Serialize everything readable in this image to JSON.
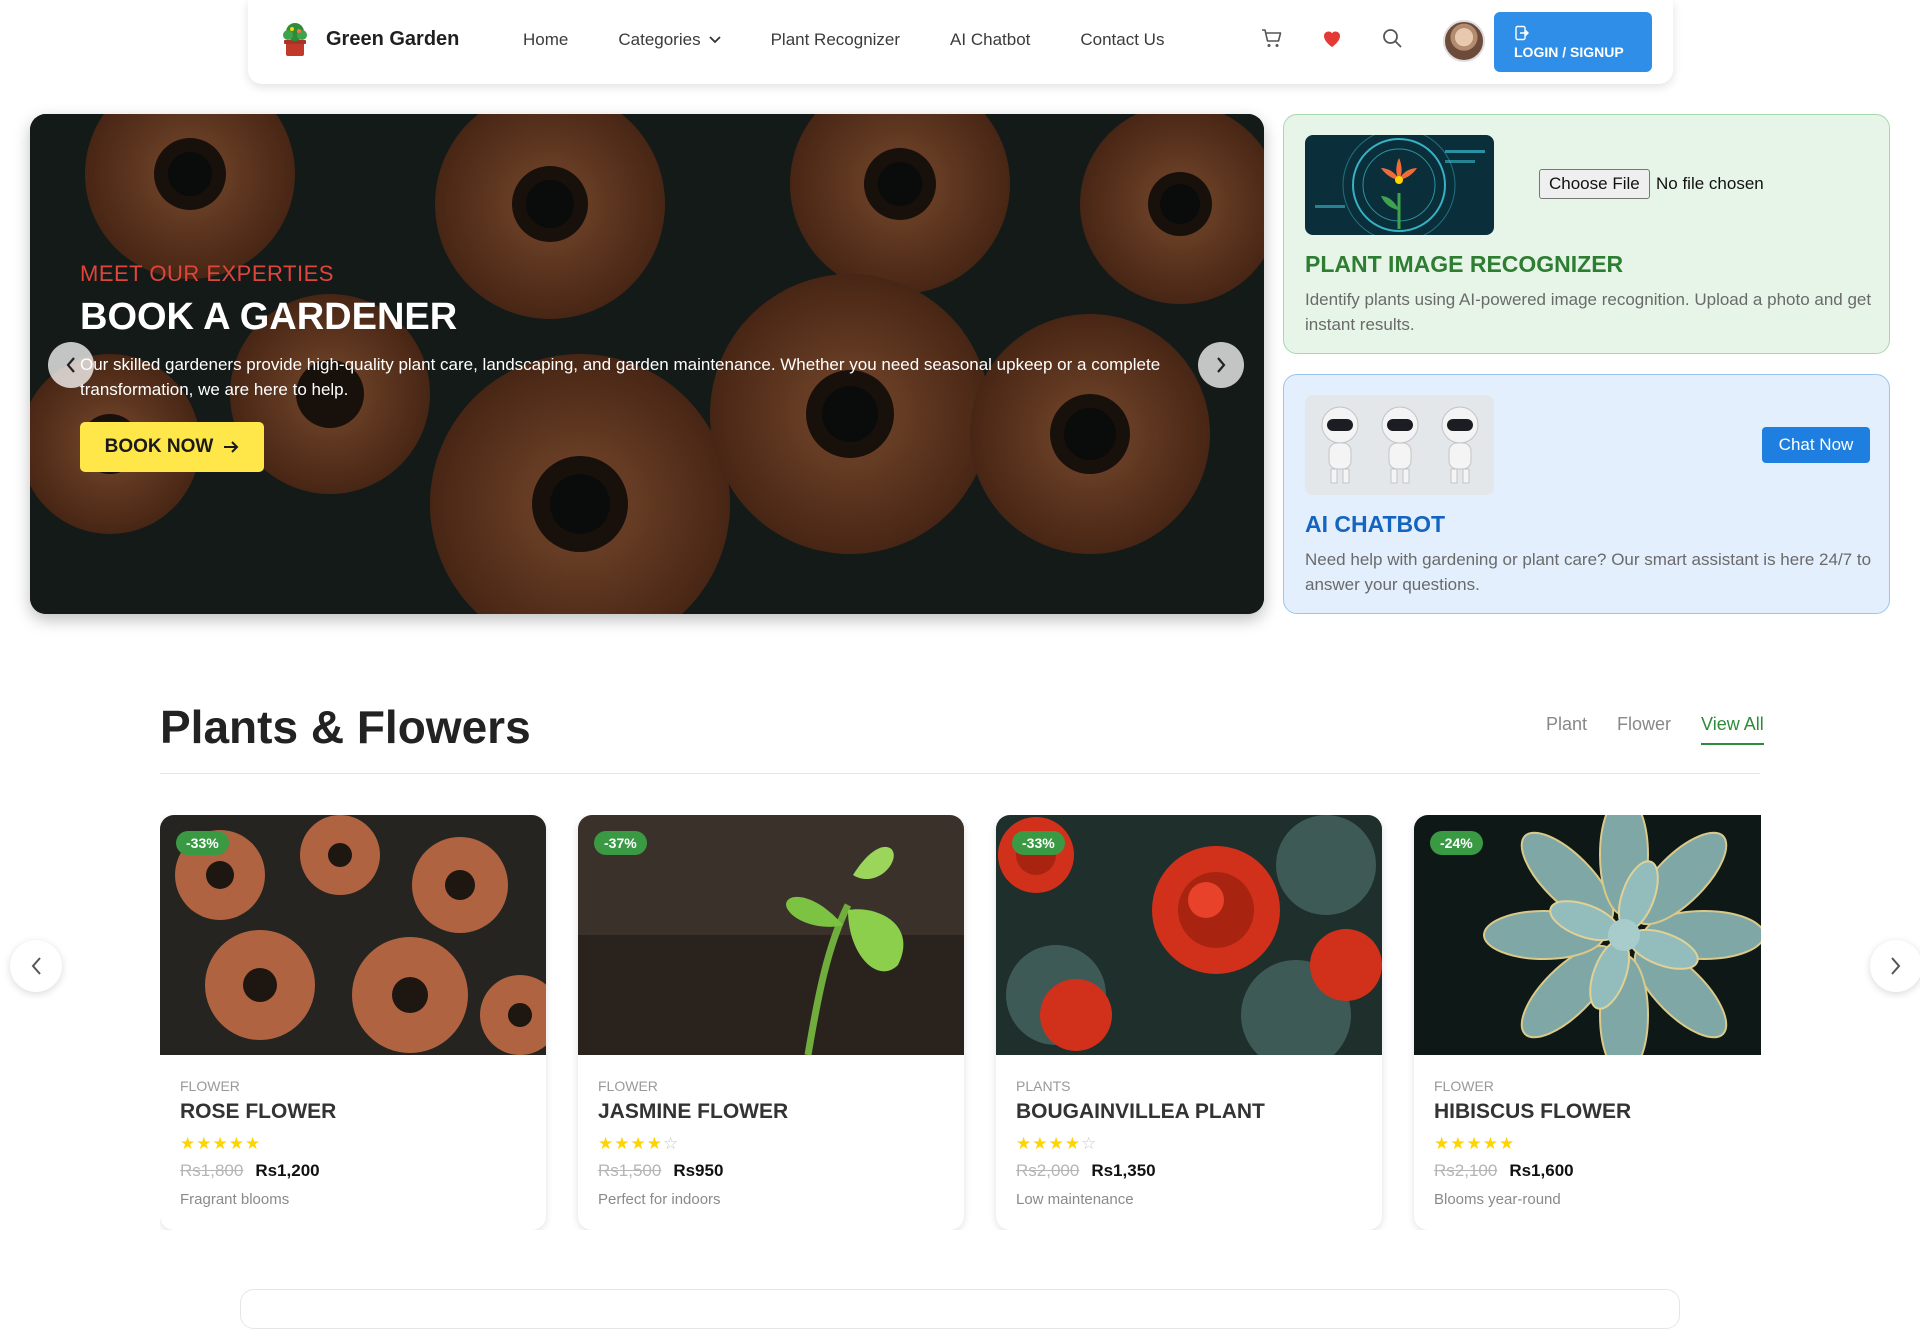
{
  "nav": {
    "brand": "Green Garden",
    "links": [
      "Home",
      "Categories",
      "Plant Recognizer",
      "AI Chatbot",
      "Contact Us"
    ],
    "login_label": "LOGIN / SIGNUP",
    "icons": [
      "cart-icon",
      "heart-icon",
      "search-icon"
    ]
  },
  "hero": {
    "tag": "MEET OUR EXPERTIES",
    "title": "BOOK A GARDENER",
    "description": "Our skilled gardeners provide high-quality plant care, landscaping, and garden maintenance. Whether you need seasonal upkeep or a complete transformation, we are here to help.",
    "button": "BOOK NOW"
  },
  "recognizer": {
    "title": "PLANT IMAGE RECOGNIZER",
    "description": "Identify plants using AI-powered image recognition. Upload a photo and get instant results.",
    "file_button": "Choose File",
    "file_status": "No file chosen",
    "color": "#2e7d32"
  },
  "chatbot": {
    "title": "AI CHATBOT",
    "description": "Need help with gardening or plant care? Our smart assistant is here 24/7 to answer your questions.",
    "button": "Chat Now",
    "color": "#1565c0"
  },
  "section": {
    "title": "Plants & Flowers",
    "filters": [
      "Plant",
      "Flower",
      "View All"
    ],
    "active_filter": "View All"
  },
  "products": [
    {
      "badge": "-33%",
      "category": "FLOWER",
      "name": "ROSE FLOWER",
      "rating": 5,
      "old_price": "Rs1,800",
      "price": "Rs1,200",
      "desc": "Fragrant blooms"
    },
    {
      "badge": "-37%",
      "category": "FLOWER",
      "name": "JASMINE FLOWER",
      "rating": 4,
      "old_price": "Rs1,500",
      "price": "Rs950",
      "desc": "Perfect for indoors"
    },
    {
      "badge": "-33%",
      "category": "PLANTS",
      "name": "BOUGAINVILLEA PLANT",
      "rating": 4,
      "old_price": "Rs2,000",
      "price": "Rs1,350",
      "desc": "Low maintenance"
    },
    {
      "badge": "-24%",
      "category": "FLOWER",
      "name": "HIBISCUS FLOWER",
      "rating": 5,
      "old_price": "Rs2,100",
      "price": "Rs1,600",
      "desc": "Blooms year-round"
    }
  ]
}
